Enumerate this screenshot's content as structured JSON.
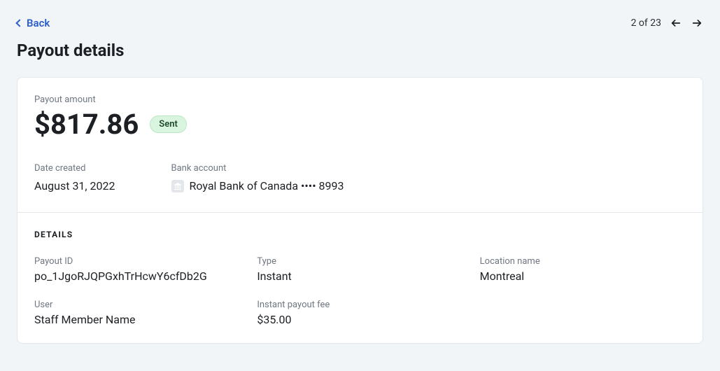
{
  "nav": {
    "back_label": "Back",
    "pagination_text": "2 of 23"
  },
  "page": {
    "title": "Payout details"
  },
  "summary": {
    "amount_label": "Payout amount",
    "amount": "$817.86",
    "status": "Sent",
    "date_created_label": "Date created",
    "date_created": "August 31, 2022",
    "bank_account_label": "Bank account",
    "bank_account": "Royal Bank of Canada •••• 8993"
  },
  "details": {
    "heading": "DETAILS",
    "items": [
      {
        "label": "Payout ID",
        "value": "po_1JgoRJQPGxhTrHcwY6cfDb2G"
      },
      {
        "label": "Type",
        "value": "Instant"
      },
      {
        "label": "Location name",
        "value": "Montreal"
      },
      {
        "label": "User",
        "value": "Staff Member Name"
      },
      {
        "label": "Instant payout fee",
        "value": "$35.00"
      }
    ]
  }
}
